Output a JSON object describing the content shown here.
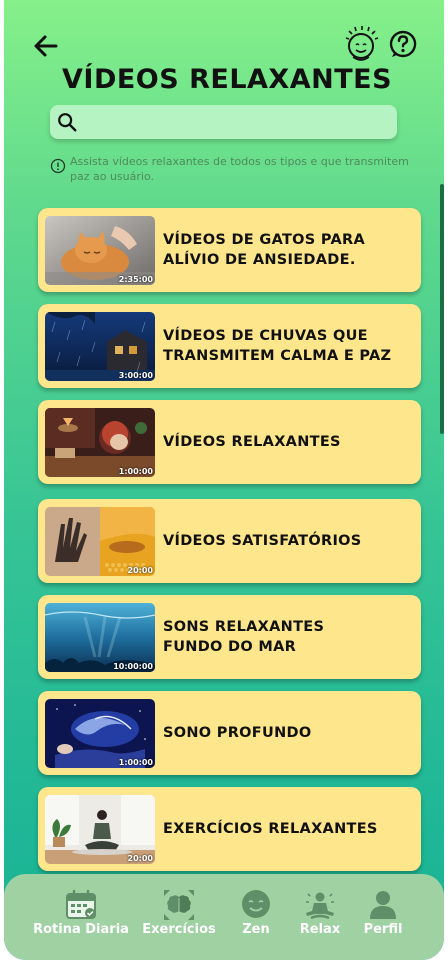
{
  "header": {
    "back_icon": "arrow-left-icon",
    "title": "VÍDEOS RELAXANTES",
    "face_icon": "smiling-face-icon",
    "help_icon": "help-question-icon"
  },
  "search": {
    "placeholder": "",
    "value": "",
    "icon": "search-icon"
  },
  "info": {
    "icon": "info-circle-icon",
    "text": "Assista vídeos relaxantes de todos os tipos e que transmitem paz ao usuário."
  },
  "videos": [
    {
      "title": "VÍDEOS DE GATOS PARA\nALÍVIO DE ANSIEDADE.",
      "duration": "2:35:00",
      "thumbnail": "cat-relaxing"
    },
    {
      "title": "VÍDEOS DE CHUVAS QUE\nTRANSMITEM CALMA E PAZ",
      "duration": "3:00:00",
      "thumbnail": "rain-house-night"
    },
    {
      "title": "VÍDEOS RELAXANTES",
      "duration": "1:00:00",
      "thumbnail": "lofi-girl"
    },
    {
      "title": "VÍDEOS SATISFATÓRIOS",
      "duration": "20:00",
      "thumbnail": "satisfying-hand-honey"
    },
    {
      "title": "SONS RELAXANTES\nFUNDO  DO MAR",
      "duration": "10:00:00",
      "thumbnail": "underwater-ocean"
    },
    {
      "title": "SONO PROFUNDO",
      "duration": "1:00:00",
      "thumbnail": "deep-sleep-galaxy"
    },
    {
      "title": "EXERCÍCIOS RELAXANTES",
      "duration": "20:00",
      "thumbnail": "meditation-yoga"
    }
  ],
  "bottom_nav": [
    {
      "label": "Rotina Diaria",
      "icon": "calendar-icon"
    },
    {
      "label": "Exercícios",
      "icon": "brain-arrows-icon"
    },
    {
      "label": "Zen",
      "icon": "zen-face-icon"
    },
    {
      "label": "Relax",
      "icon": "meditation-icon"
    },
    {
      "label": "Perfil",
      "icon": "user-icon"
    }
  ],
  "colors": {
    "card": "#fde68b",
    "search_bg": "#b6f3c3",
    "nav_bg": "#9fd1a3",
    "icon_green": "#1f7a3a"
  }
}
